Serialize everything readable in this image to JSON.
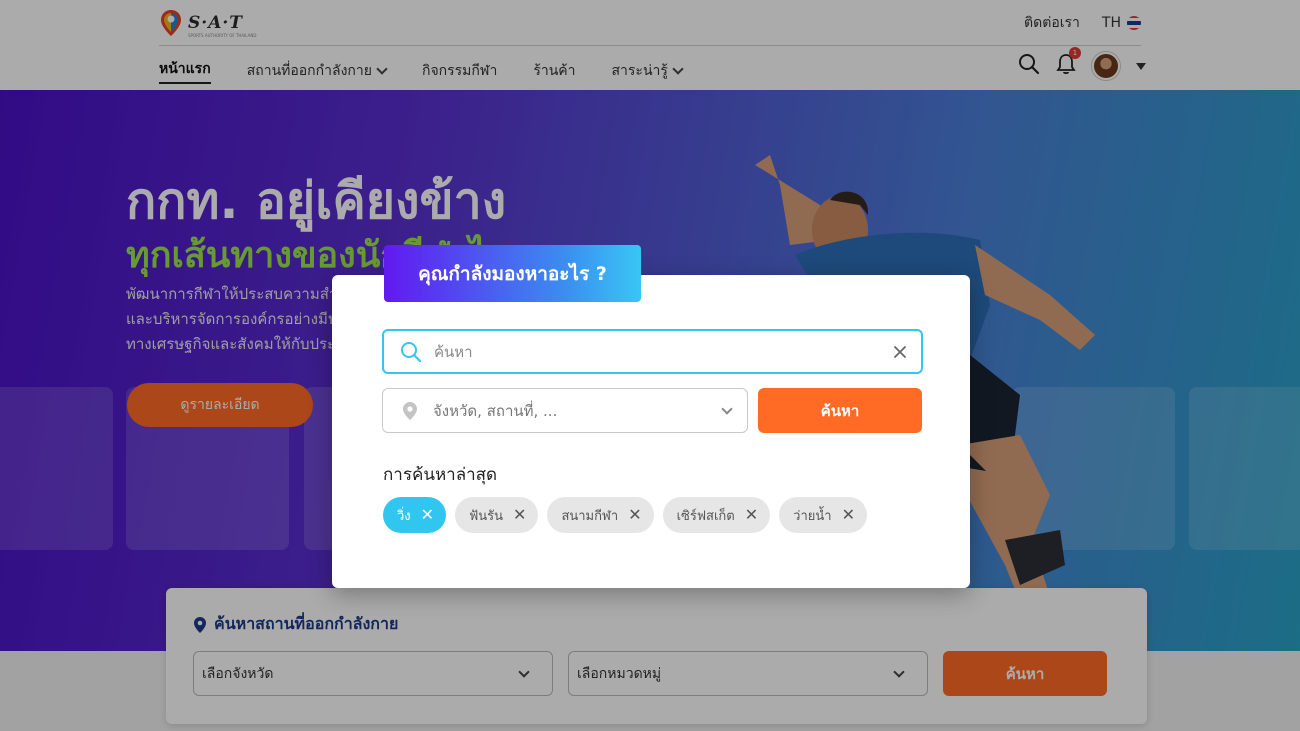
{
  "header": {
    "logo_text": "S·A·T",
    "logo_tagline": "SPORTS AUTHORITY OF THAILAND",
    "contact_label": "ติดต่อเรา",
    "lang_label": "TH",
    "notification_count": "1",
    "nav": [
      {
        "label": "หน้าแรก",
        "dropdown": false
      },
      {
        "label": "สถานที่ออกกำลังกาย",
        "dropdown": true
      },
      {
        "label": "กิจกรรมกีฬา",
        "dropdown": false
      },
      {
        "label": "ร้านค้า",
        "dropdown": false
      },
      {
        "label": "สาระน่ารู้",
        "dropdown": true
      }
    ]
  },
  "hero": {
    "title_line1": "กกท. อยู่เคียงข้าง",
    "title_line2": "ทุกเส้นทางของนักกีฬาไทย",
    "desc_line1": "พัฒนาการกีฬาให้ประสบความสำเร็จ",
    "desc_line2": "และบริหารจัดการองค์กรอย่างมีประสิทธิภาพ",
    "desc_line3": "ทางเศรษฐกิจและสังคมให้กับประเทศ",
    "cta_label": "ดูรายละเอียด"
  },
  "venue_search": {
    "title": "ค้นหาสถานที่ออกกำลังกาย",
    "province_placeholder": "เลือกจังหวัด",
    "category_placeholder": "เลือกหมวดหมู่",
    "button_label": "ค้นหา"
  },
  "modal": {
    "tab_title": "คุณกำลังมองหาอะไร ?",
    "search_placeholder": "ค้นหา",
    "location_placeholder": "จังหวัด, สถานที่, ...",
    "search_button": "ค้นหา",
    "recent_title": "การค้นหาล่าสุด",
    "recent": [
      {
        "label": "วิ่ง",
        "active": true
      },
      {
        "label": "ฟันรัน",
        "active": false
      },
      {
        "label": "สนามกีฬา",
        "active": false
      },
      {
        "label": "เซิร์ฟสเก็ต",
        "active": false
      },
      {
        "label": "ว่ายน้ำ",
        "active": false
      }
    ]
  },
  "colors": {
    "accent_orange": "#ff6a25",
    "accent_cyan": "#31c6ef",
    "hero_green": "#9be64a",
    "brand_navy": "#1d3b8a"
  }
}
